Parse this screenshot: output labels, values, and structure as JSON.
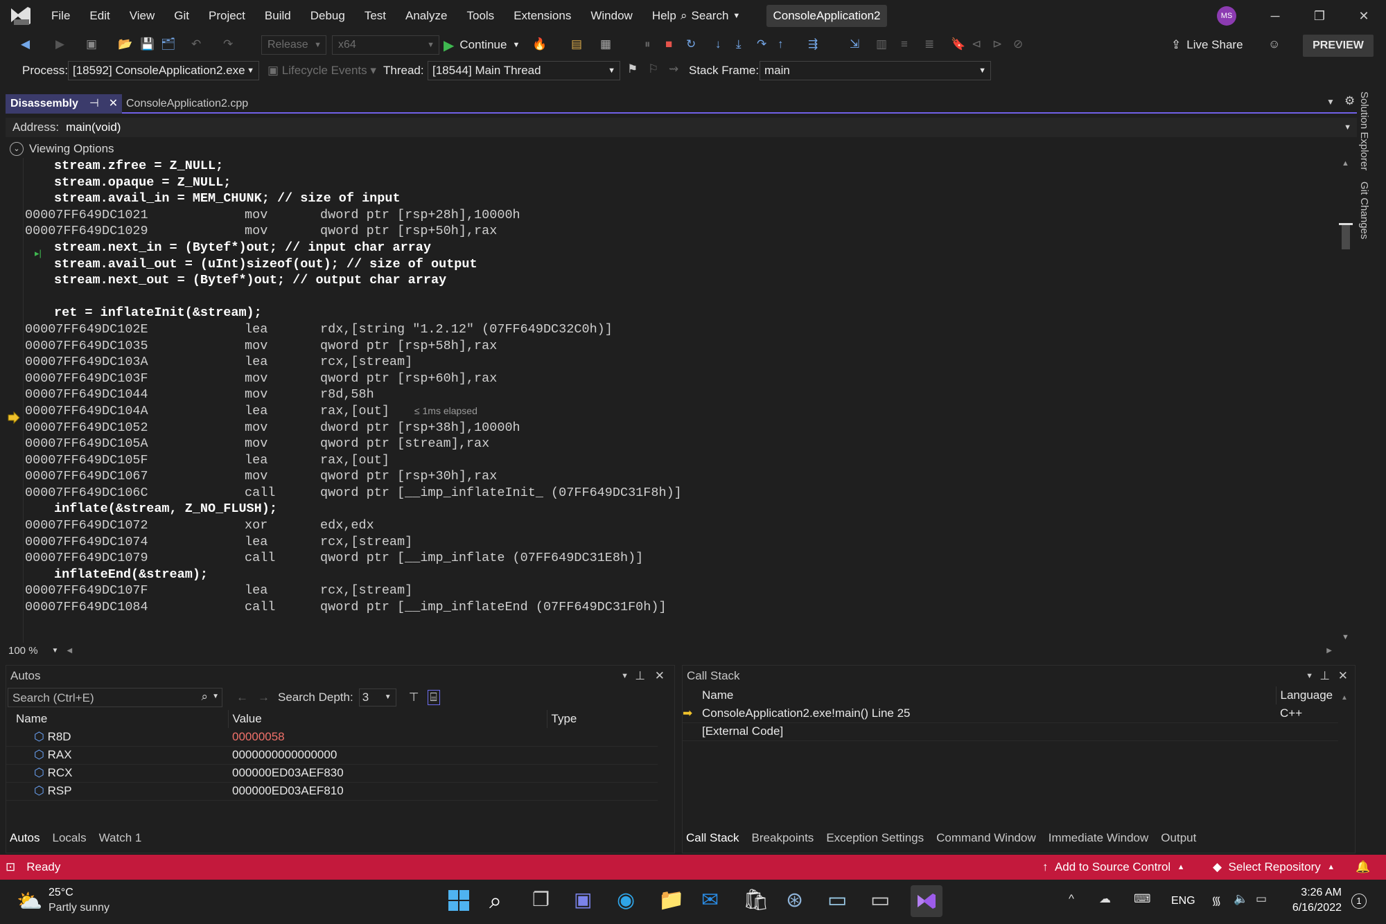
{
  "menu": [
    "File",
    "Edit",
    "View",
    "Git",
    "Project",
    "Build",
    "Debug",
    "Test",
    "Analyze",
    "Tools",
    "Extensions",
    "Window",
    "Help"
  ],
  "search_label": "Search",
  "solution_name": "ConsoleApplication2",
  "avatar_initials": "MS",
  "toolbar": {
    "config": "Release",
    "platform": "x64",
    "continue_label": "Continue",
    "live_share": "Live Share",
    "preview": "PREVIEW"
  },
  "debugbar": {
    "process_label": "Process:",
    "process_value": "[18592] ConsoleApplication2.exe",
    "lifecycle": "Lifecycle Events",
    "thread_label": "Thread:",
    "thread_value": "[18544] Main Thread",
    "stackframe_label": "Stack Frame:",
    "stackframe_value": "main"
  },
  "tabs": {
    "disassembly": "Disassembly",
    "source": "ConsoleApplication2.cpp"
  },
  "address": {
    "label": "Address:",
    "value": "main(void)"
  },
  "viewing_options": "Viewing Options",
  "code_lines": [
    {
      "kind": "src",
      "text": "stream.zfree = Z_NULL;"
    },
    {
      "kind": "src",
      "text": "stream.opaque = Z_NULL;"
    },
    {
      "kind": "src",
      "text": "stream.avail_in = MEM_CHUNK; // size of input"
    },
    {
      "kind": "asm",
      "addr": "00007FF649DC1021",
      "op": "mov",
      "args": "dword ptr [rsp+28h],10000h"
    },
    {
      "kind": "asm",
      "addr": "00007FF649DC1029",
      "op": "mov",
      "args": "qword ptr [rsp+50h],rax"
    },
    {
      "kind": "src",
      "text": "stream.next_in = (Bytef*)out; // input char array"
    },
    {
      "kind": "src",
      "text": "stream.avail_out = (uInt)sizeof(out); // size of output"
    },
    {
      "kind": "src",
      "text": "stream.next_out = (Bytef*)out; // output char array"
    },
    {
      "kind": "src",
      "text": ""
    },
    {
      "kind": "src",
      "text": "ret = inflateInit(&stream);"
    },
    {
      "kind": "asm",
      "addr": "00007FF649DC102E",
      "op": "lea",
      "args": "rdx,[string \"1.2.12\" (07FF649DC32C0h)]"
    },
    {
      "kind": "asm",
      "addr": "00007FF649DC1035",
      "op": "mov",
      "args": "qword ptr [rsp+58h],rax"
    },
    {
      "kind": "asm",
      "addr": "00007FF649DC103A",
      "op": "lea",
      "args": "rcx,[stream]"
    },
    {
      "kind": "asm",
      "addr": "00007FF649DC103F",
      "op": "mov",
      "args": "qword ptr [rsp+60h],rax"
    },
    {
      "kind": "asm",
      "addr": "00007FF649DC1044",
      "op": "mov",
      "args": "r8d,58h"
    },
    {
      "kind": "asm",
      "addr": "00007FF649DC104A",
      "op": "lea",
      "args": "rax,[out]",
      "note": "≤ 1ms elapsed"
    },
    {
      "kind": "asm",
      "addr": "00007FF649DC1052",
      "op": "mov",
      "args": "dword ptr [rsp+38h],10000h"
    },
    {
      "kind": "asm",
      "addr": "00007FF649DC105A",
      "op": "mov",
      "args": "qword ptr [stream],rax"
    },
    {
      "kind": "asm",
      "addr": "00007FF649DC105F",
      "op": "lea",
      "args": "rax,[out]"
    },
    {
      "kind": "asm",
      "addr": "00007FF649DC1067",
      "op": "mov",
      "args": "qword ptr [rsp+30h],rax"
    },
    {
      "kind": "asm",
      "addr": "00007FF649DC106C",
      "op": "call",
      "args": "qword ptr [__imp_inflateInit_ (07FF649DC31F8h)]"
    },
    {
      "kind": "src",
      "text": "inflate(&stream, Z_NO_FLUSH);"
    },
    {
      "kind": "asm",
      "addr": "00007FF649DC1072",
      "op": "xor",
      "args": "edx,edx"
    },
    {
      "kind": "asm",
      "addr": "00007FF649DC1074",
      "op": "lea",
      "args": "rcx,[stream]"
    },
    {
      "kind": "asm",
      "addr": "00007FF649DC1079",
      "op": "call",
      "args": "qword ptr [__imp_inflate (07FF649DC31E8h)]"
    },
    {
      "kind": "src",
      "text": "inflateEnd(&stream);"
    },
    {
      "kind": "asm",
      "addr": "00007FF649DC107F",
      "op": "lea",
      "args": "rcx,[stream]"
    },
    {
      "kind": "asm",
      "addr": "00007FF649DC1084",
      "op": "call",
      "args": "qword ptr [__imp_inflateEnd (07FF649DC31F0h)]"
    }
  ],
  "zoom": "100 %",
  "autos": {
    "title": "Autos",
    "search_placeholder": "Search (Ctrl+E)",
    "depth_label": "Search Depth:",
    "depth_value": "3",
    "columns": [
      "Name",
      "Value",
      "Type"
    ],
    "rows": [
      {
        "name": "R8D",
        "value": "00000058",
        "changed": true
      },
      {
        "name": "RAX",
        "value": "0000000000000000",
        "changed": false
      },
      {
        "name": "RCX",
        "value": "000000ED03AEF830",
        "changed": false
      },
      {
        "name": "RSP",
        "value": "000000ED03AEF810",
        "changed": false
      }
    ],
    "tabs": [
      "Autos",
      "Locals",
      "Watch 1"
    ]
  },
  "callstack": {
    "title": "Call Stack",
    "columns": [
      "Name",
      "Language"
    ],
    "rows": [
      {
        "name": "ConsoleApplication2.exe!main() Line 25",
        "lang": "C++"
      },
      {
        "name": "[External Code]",
        "lang": ""
      }
    ],
    "tabs": [
      "Call Stack",
      "Breakpoints",
      "Exception Settings",
      "Command Window",
      "Immediate Window",
      "Output"
    ]
  },
  "side_tabs": [
    "Solution Explorer",
    "Git Changes"
  ],
  "status": {
    "ready": "Ready",
    "source_control": "Add to Source Control",
    "repository": "Select Repository"
  },
  "taskbar": {
    "temp": "25°C",
    "weather": "Partly sunny",
    "lang": "ENG",
    "time": "3:26 AM",
    "date": "6/16/2022",
    "notif_count": "1"
  },
  "colors": {
    "accent": "#7160e8",
    "status": "#c3193c",
    "changed_value": "#f0716a"
  }
}
